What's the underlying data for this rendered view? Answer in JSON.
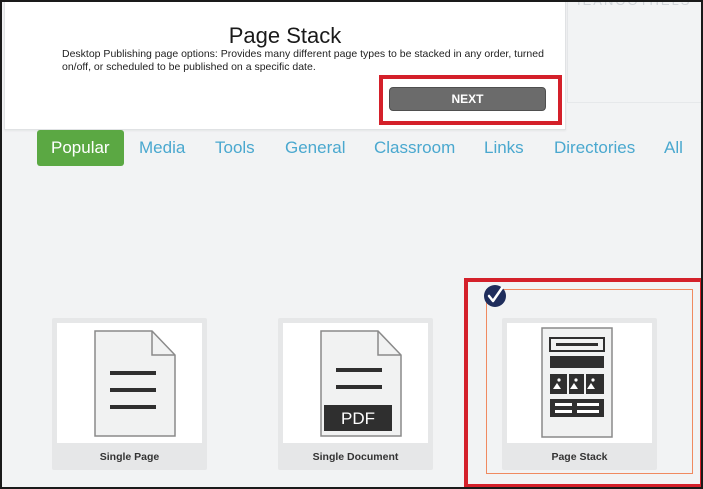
{
  "tooltip": {
    "title": "Page Stack",
    "description": "Desktop Publishing page options: Provides many different page types to be stacked in any order, turned on/off, or scheduled to be published on a specific date.",
    "next_label": "NEXT"
  },
  "background_text": "IEANOOTHELS",
  "tabs": [
    {
      "label": "Popular",
      "active": true
    },
    {
      "label": "Media",
      "active": false
    },
    {
      "label": "Tools",
      "active": false
    },
    {
      "label": "General",
      "active": false
    },
    {
      "label": "Classroom",
      "active": false
    },
    {
      "label": "Links",
      "active": false
    },
    {
      "label": "Directories",
      "active": false
    },
    {
      "label": "All",
      "active": false
    }
  ],
  "cards": [
    {
      "label": "Single Page",
      "icon": "single-page-icon",
      "selected": false
    },
    {
      "label": "Single Document",
      "icon": "pdf-document-icon",
      "pdf_text": "PDF",
      "selected": false
    },
    {
      "label": "Page Stack",
      "icon": "page-stack-icon",
      "selected": true
    }
  ],
  "colors": {
    "accent_green": "#5ba843",
    "tab_text": "#4aa8cf",
    "highlight_red": "#d4202a",
    "selection_orange": "#f08a60",
    "check_navy": "#1f2d5c"
  }
}
